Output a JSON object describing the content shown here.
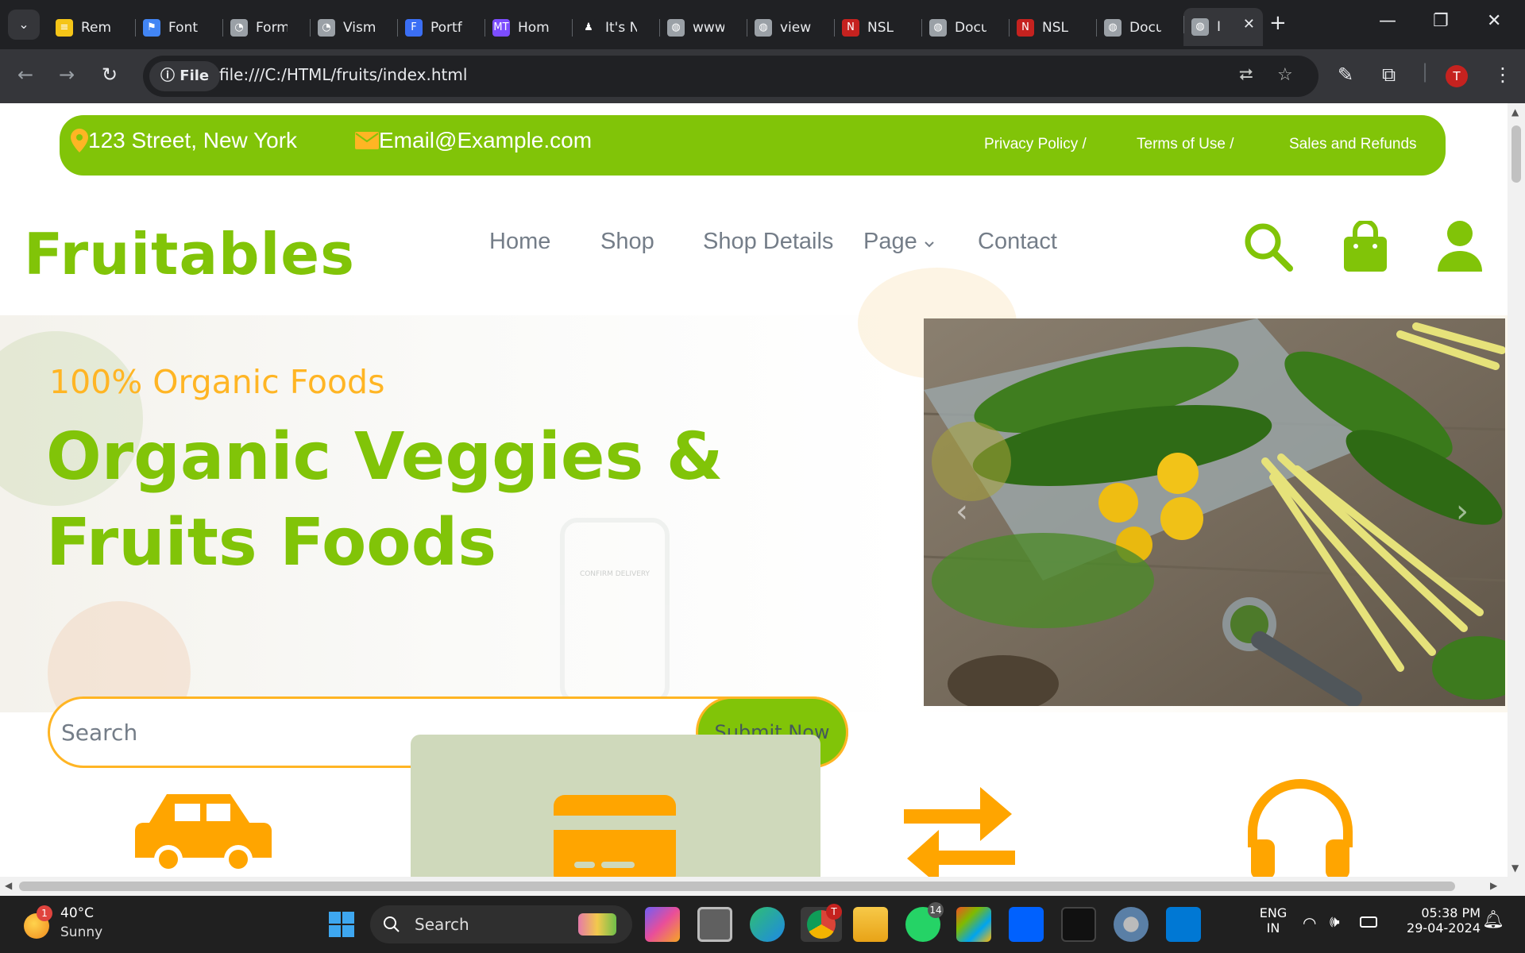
{
  "browser": {
    "tabs": [
      {
        "title": "Rem",
        "favicon_color": "#f5c518",
        "favicon_glyph": "≡"
      },
      {
        "title": "Font",
        "favicon_color": "#4285f4",
        "favicon_glyph": "⚑"
      },
      {
        "title": "Form",
        "favicon_color": "#9aa0a6",
        "favicon_glyph": "◔"
      },
      {
        "title": "Vism",
        "favicon_color": "#9aa0a6",
        "favicon_glyph": "◔"
      },
      {
        "title": "Portf",
        "favicon_color": "#3b6ff5",
        "favicon_glyph": "F"
      },
      {
        "title": "Hom",
        "favicon_color": "#7c4dff",
        "favicon_glyph": "MT"
      },
      {
        "title": "It's N",
        "favicon_color": "#202124",
        "favicon_glyph": "♟"
      },
      {
        "title": "www",
        "favicon_color": "#9aa0a6",
        "favicon_glyph": "◍"
      },
      {
        "title": "view",
        "favicon_color": "#9aa0a6",
        "favicon_glyph": "◍"
      },
      {
        "title": "NSL",
        "favicon_color": "#c5221f",
        "favicon_glyph": "N"
      },
      {
        "title": "Docu",
        "favicon_color": "#9aa0a6",
        "favicon_glyph": "◍"
      },
      {
        "title": "NSL",
        "favicon_color": "#c5221f",
        "favicon_glyph": "N"
      },
      {
        "title": "Docu",
        "favicon_color": "#9aa0a6",
        "favicon_glyph": "◍"
      },
      {
        "title": "I",
        "favicon_color": "#9aa0a6",
        "favicon_glyph": "◍",
        "active": true
      }
    ],
    "file_chip": "File",
    "url": "file:///C:/HTML/fruits/index.html",
    "profile_initial": "T"
  },
  "page": {
    "topbar": {
      "address": "123 Street, New York",
      "email": "Email@Example.com",
      "links": [
        "Privacy Policy /",
        "Terms of Use /",
        "Sales and Refunds"
      ]
    },
    "brand": "Fruitables",
    "nav": {
      "home": "Home",
      "shop": "Shop",
      "shop_details": "Shop Details",
      "page": "Page",
      "contact": "Contact"
    },
    "hero": {
      "subtitle": "100% Organic Foods",
      "title": "Organic Veggies & Fruits Foods",
      "search_placeholder": "Search",
      "submit_label": "Submit Now",
      "phone_text": "CONFIRM DELIVERY"
    },
    "features": [
      {
        "icon": "car-icon"
      },
      {
        "icon": "credit-card-icon",
        "highlighted": true
      },
      {
        "icon": "exchange-icon"
      },
      {
        "icon": "headset-icon"
      }
    ]
  },
  "colors": {
    "brand_green": "#81c408",
    "accent_orange": "#ffb524",
    "nav_text": "#747d88",
    "feature_highlight": "#cfd9bb"
  },
  "taskbar": {
    "weather_temp": "40°C",
    "weather_desc": "Sunny",
    "weather_badge": "1",
    "search_label": "Search",
    "whatsapp_badge": "14",
    "chrome_badge": "T",
    "lang_line1": "ENG",
    "lang_line2": "IN",
    "time": "05:38 PM",
    "date": "29-04-2024"
  }
}
